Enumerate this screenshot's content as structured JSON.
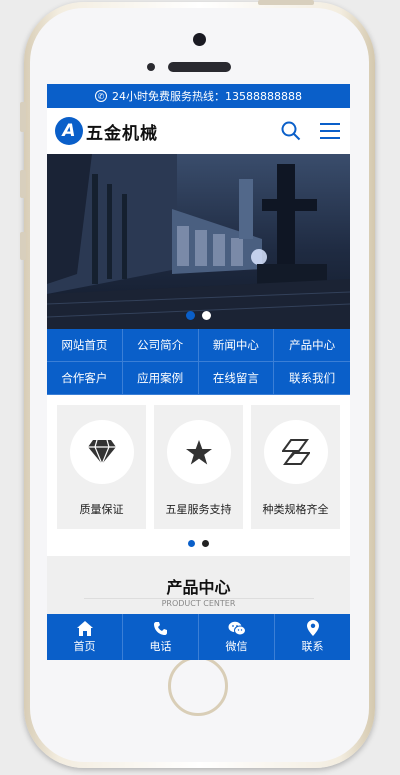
{
  "hotline": {
    "text": "24小时免费服务热线：13588888888"
  },
  "header": {
    "logo_letter": "A",
    "brand": "五金机械"
  },
  "nav": [
    "网站首页",
    "公司简介",
    "新闻中心",
    "产品中心",
    "合作客户",
    "应用案例",
    "在线留言",
    "联系我们"
  ],
  "features": [
    {
      "icon": "diamond-icon",
      "label": "质量保证"
    },
    {
      "icon": "star-icon",
      "label": "五星服务支持"
    },
    {
      "icon": "layers-icon",
      "label": "种类规格齐全"
    }
  ],
  "products": {
    "title": "产品中心",
    "subtitle": "PRODUCT CENTER"
  },
  "tabbar": [
    {
      "icon": "home-icon",
      "label": "首页"
    },
    {
      "icon": "phone-icon",
      "label": "电话"
    },
    {
      "icon": "wechat-icon",
      "label": "微信"
    },
    {
      "icon": "location-icon",
      "label": "联系"
    }
  ],
  "colors": {
    "primary": "#0a5fc9"
  }
}
